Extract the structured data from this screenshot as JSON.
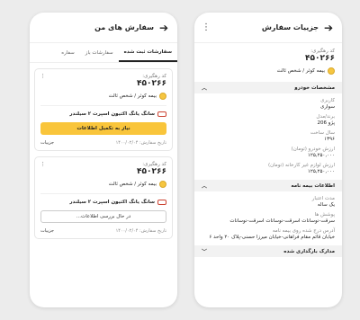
{
  "left_phone": {
    "title": "سفارش های من",
    "tabs": [
      "سفارشات ثبت شده",
      "سفارشات باز",
      "سفاره"
    ],
    "cards": [
      {
        "tracking_label": "کد رهگیری:",
        "tracking_number": "۴۵۰۲۶۶",
        "insurer": "بیمه کوثر / شخص ثالث",
        "car": "سانگ یانگ اکتیون اسپرت ۲ سیلندر",
        "action": "نیاز به تکمیل اطلاعات",
        "action_style": "yellow",
        "details": "جزییات",
        "date": "تاریخ سفارش: ۱۴۰۰/۰۲/۰۴"
      },
      {
        "tracking_label": "کد رهگیری:",
        "tracking_number": "۴۵۰۲۶۶",
        "insurer": "بیمه کوثر / شخص ثالث",
        "car": "سانگ یانگ اکتیون اسپرت ۲ سیلندر",
        "action": "در حال بررسی اطلاعات...",
        "action_style": "outline",
        "details": "جزییات",
        "date": "تاریخ سفارش: ۱۴۰۰/۰۲/۰۴"
      }
    ]
  },
  "right_phone": {
    "title": "جزییات سفارش",
    "tracking_label": "کد رهگیری:",
    "tracking_number": "۴۵۰۲۶۶",
    "insurer": "بیمه کوثر / شخص ثالث",
    "vehicle_section": "مشخصات خودرو",
    "vehicle": [
      {
        "k": "کاربری",
        "v": "سواری"
      },
      {
        "k": "برند/مدل",
        "v": "پژو 206"
      },
      {
        "k": "سال ساخت",
        "v": "۱۳۹۶"
      },
      {
        "k": "ارزش خودرو (تومان)",
        "v": "۱۲۵,۲۵۰,۰۰۰"
      },
      {
        "k": "ارزش لوازم غیر کارخانه (تومان)",
        "v": "۱۲۵,۲۵۰,۰۰۰"
      }
    ],
    "insurance_section": "اطلاعات بیمه نامه",
    "insurance": [
      {
        "k": "مدت اعتبار",
        "v": "یک ساله"
      },
      {
        "k": "پوشش ها",
        "v": "سرقت-نوسانات اسرقت-نوسانات اسرقت-نوسانات"
      },
      {
        "k": "آدرس درج شده روی بیمه نامه",
        "v": "خیابان قائم مقام فراهانی-خیابان میرزا حسنی-پلاک ۲۰ واحد ۶"
      }
    ],
    "docs_section": "مدارک بارگذاری شده"
  }
}
